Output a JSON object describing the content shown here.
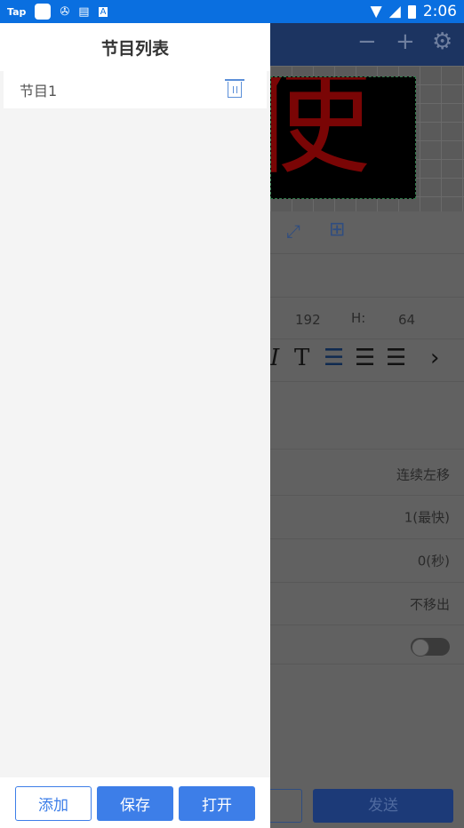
{
  "status_bar": {
    "app_label": "Tap",
    "time": "2:06"
  },
  "background_app": {
    "canvas_text": "使",
    "width_value": "192",
    "height_label": "H:",
    "height_value": "64",
    "rows": [
      {
        "value": "连续左移"
      },
      {
        "value": "1(最快)"
      },
      {
        "value": "0(秒)"
      },
      {
        "value": "不移出"
      }
    ],
    "toggle_on": false,
    "send_label": "发送"
  },
  "drawer": {
    "title": "节目列表",
    "items": [
      {
        "label": "节目1"
      }
    ],
    "buttons": {
      "add": "添加",
      "save": "保存",
      "open": "打开"
    }
  },
  "colors": {
    "accent": "#3d7ee8",
    "status_bar": "#0a6fe0"
  }
}
